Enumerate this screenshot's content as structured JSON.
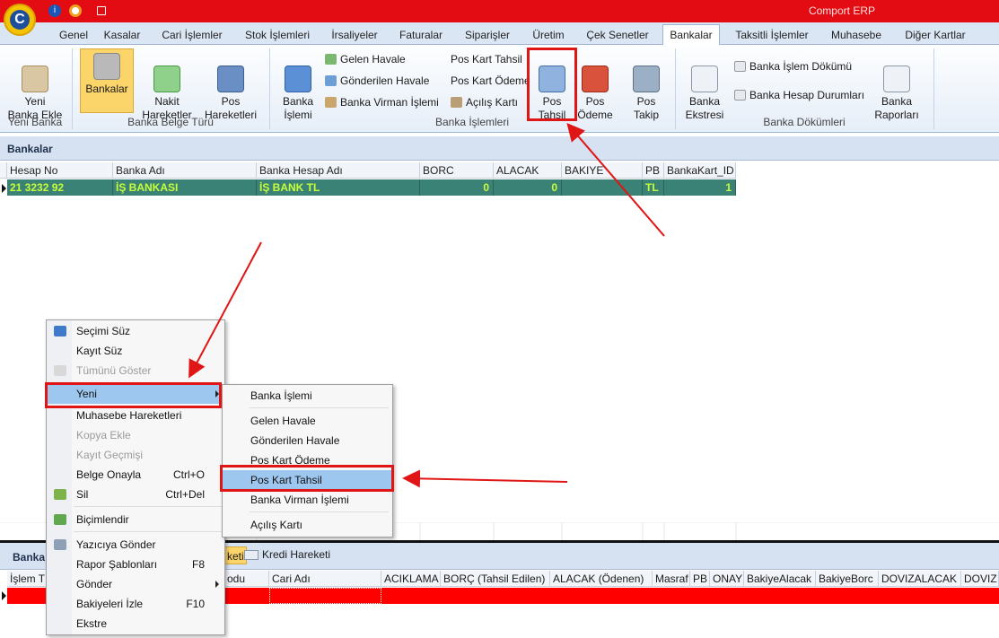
{
  "titlebar": {
    "app_title": "Comport ERP",
    "logo_letter": "C",
    "info_icon": "i"
  },
  "tabs": [
    "Genel",
    "Kasalar",
    "Cari İşlemler",
    "Stok İşlemleri",
    "İrsaliyeler",
    "Faturalar",
    "Siparişler",
    "Üretim",
    "Çek Senetler",
    "Bankalar",
    "Taksitli İşlemler",
    "Muhasebe",
    "Diğer Kartlar"
  ],
  "active_tab": "Bankalar",
  "ribbon": {
    "yeni_banka_ekle": "Yeni\nBanka Ekle",
    "grp_yeni_banka": "Yeni Banka",
    "bankalar": "Bankalar",
    "nakit_hareketler": "Nakit\nHareketler",
    "pos_hareketleri": "Pos\nHareketleri",
    "grp_banka_belge_turu": "Banka Belge Türü",
    "banka_islemi": "Banka\nİşlemi",
    "gelen_havale": "Gelen Havale",
    "gonderilen_havale": "Gönderilen Havale",
    "banka_virman": "Banka Virman İşlemi",
    "pos_kart_tahsil": "Pos Kart Tahsil",
    "pos_kart_odeme": "Pos Kart Ödeme",
    "acilis_karti": "Açılış Kartı",
    "pos_tahsil": "Pos\nTahsil",
    "pos_odeme": "Pos\nÖdeme",
    "pos_takip": "Pos\nTakip",
    "grp_banka_islemleri": "Banka İşlemleri",
    "banka_ekstresi": "Banka\nEkstresi",
    "banka_islem_dokumu": "Banka İşlem Dökümü",
    "banka_hesap_durumlari": "Banka Hesap Durumları",
    "banka_raporlari": "Banka\nRaporları",
    "grp_banka_dokumleri": "Banka Dökümleri"
  },
  "bank_panel": {
    "title": "Bankalar"
  },
  "bank_grid": {
    "columns": [
      "Hesap No",
      "Banka Adı",
      "Banka Hesap Adı",
      "BORC",
      "ALACAK",
      "BAKIYE",
      "PB",
      "BankaKart_ID"
    ],
    "rows": [
      [
        "21 3232 92",
        "İŞ BANKASI",
        "İŞ BANK TL",
        "0",
        "0",
        "",
        "TL",
        "1"
      ]
    ]
  },
  "bottom_panel": {
    "title_partial": "Banka",
    "tab_partial": "keti",
    "tab_kredi": "Kredi Hareketi",
    "columns": [
      "İşlem T",
      "odu",
      "Cari Adı",
      "ACIKLAMA",
      "BORÇ (Tahsil Edilen)",
      "ALACAK (Ödenen)",
      "Masraf",
      "PB",
      "ONAY",
      "BakiyeAlacak",
      "BakiyeBorc",
      "DOVIZALACAK",
      "DOVIZ"
    ]
  },
  "context_menu": {
    "items": [
      {
        "label": "Seçimi Süz",
        "shortcut": "",
        "disabled": false
      },
      {
        "label": "Kayıt Süz",
        "shortcut": "",
        "disabled": false
      },
      {
        "label": "Tümünü Göster",
        "shortcut": "",
        "disabled": true
      },
      {
        "label": "Yeni",
        "shortcut": "",
        "disabled": false
      },
      {
        "label": "Muhasebe Hareketleri",
        "shortcut": "",
        "disabled": false
      },
      {
        "label": "Kopya Ekle",
        "shortcut": "",
        "disabled": true
      },
      {
        "label": "Kayıt Geçmişi",
        "shortcut": "",
        "disabled": true
      },
      {
        "label": "Belge Onayla",
        "shortcut": "Ctrl+O",
        "disabled": false
      },
      {
        "label": "Sil",
        "shortcut": "Ctrl+Del",
        "disabled": false
      },
      {
        "label": "Biçimlendir",
        "shortcut": "",
        "disabled": false
      },
      {
        "label": "Yazıcıya Gönder",
        "shortcut": "",
        "disabled": false
      },
      {
        "label": "Rapor Şablonları",
        "shortcut": "F8",
        "disabled": false
      },
      {
        "label": "Gönder",
        "shortcut": "",
        "disabled": false
      },
      {
        "label": "Bakiyeleri İzle",
        "shortcut": "F10",
        "disabled": false
      },
      {
        "label": "Ekstre",
        "shortcut": "",
        "disabled": false
      }
    ]
  },
  "submenu": {
    "items": [
      "Banka İşlemi",
      "Gelen Havale",
      "Gönderilen Havale",
      "Pos Kart Ödeme",
      "Pos Kart Tahsil",
      "Banka Virman İşlemi",
      "Açılış Kartı"
    ],
    "highlighted": "Pos Kart Tahsil"
  },
  "colors": {
    "title_red": "#e20c12",
    "highlight_row": "#3a8276",
    "highlight_text": "#c6ff3a",
    "annotation_red": "#e01515"
  }
}
